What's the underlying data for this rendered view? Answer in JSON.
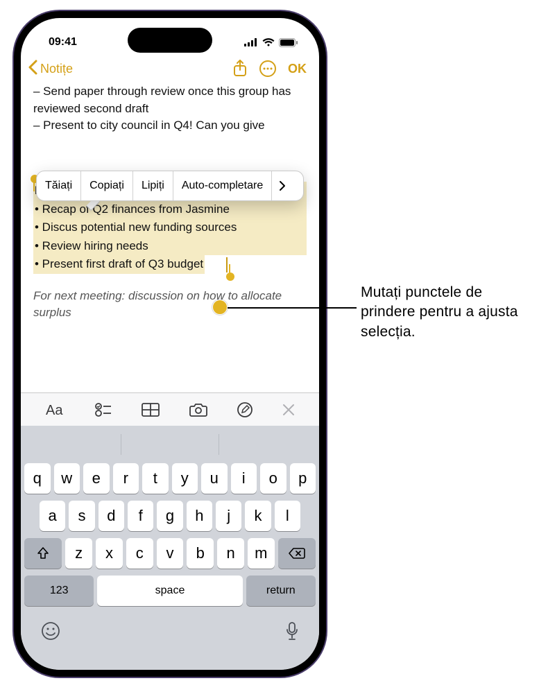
{
  "status": {
    "time": "09:41"
  },
  "nav": {
    "back_label": "Notițe",
    "ok_label": "OK"
  },
  "note": {
    "line1": "– Send paper through review once this group has reviewed second draft",
    "line2": "– Present to city council in Q4! Can you give",
    "selection_title": "Budget check-in",
    "bullet1": "• Recap of Q2 finances from Jasmine",
    "bullet2": "• Discus potential new funding sources",
    "bullet3": "• Review hiring needs",
    "bullet4": "• Present first draft of Q3 budget",
    "italic": "For next meeting: discussion on how to allocate surplus"
  },
  "edit_menu": {
    "cut": "Tăiați",
    "copy": "Copiați",
    "paste": "Lipiți",
    "auto": "Auto-completare"
  },
  "keyboard": {
    "row1": [
      "q",
      "w",
      "e",
      "r",
      "t",
      "y",
      "u",
      "i",
      "o",
      "p"
    ],
    "row2": [
      "a",
      "s",
      "d",
      "f",
      "g",
      "h",
      "j",
      "k",
      "l"
    ],
    "row3": [
      "z",
      "x",
      "c",
      "v",
      "b",
      "n",
      "m"
    ],
    "num": "123",
    "space": "space",
    "return": "return"
  },
  "callout": {
    "text": "Mutați punctele de prindere pentru a ajusta selecția."
  }
}
